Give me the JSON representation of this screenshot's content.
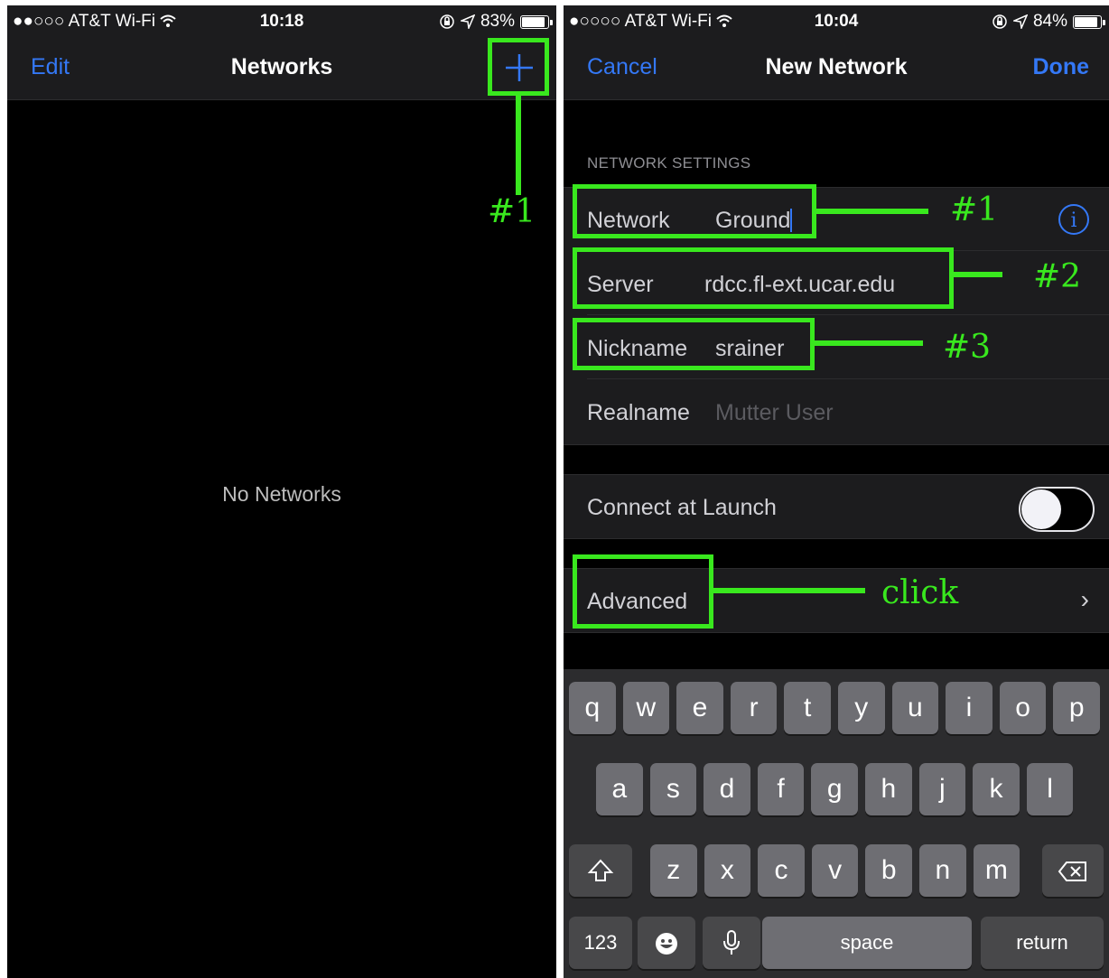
{
  "left_screen": {
    "status": {
      "carrier": "●●○○○ AT&T Wi-Fi",
      "time": "10:18",
      "battery": "83%"
    },
    "nav": {
      "edit": "Edit",
      "title": "Networks"
    },
    "empty_text": "No Networks",
    "annotation": "#1"
  },
  "right_screen": {
    "status": {
      "carrier": "●○○○○ AT&T Wi-Fi",
      "time": "10:04",
      "battery": "84%"
    },
    "nav": {
      "cancel": "Cancel",
      "title": "New Network",
      "done": "Done"
    },
    "section_header": "NETWORK SETTINGS",
    "fields": [
      {
        "label": "Network",
        "value": "Ground"
      },
      {
        "label": "Server",
        "value": "rdcc.fl-ext.ucar.edu"
      },
      {
        "label": "Nickname",
        "value": "srainer"
      },
      {
        "label": "Realname",
        "placeholder": "Mutter User"
      }
    ],
    "connect_label": "Connect at Launch",
    "connect_enabled": false,
    "advanced_label": "Advanced",
    "annotations": {
      "network": "#1",
      "server": "#2",
      "nickname": "#3",
      "advanced": "click"
    }
  },
  "keyboard": {
    "row1": [
      "q",
      "w",
      "e",
      "r",
      "t",
      "y",
      "u",
      "i",
      "o",
      "p"
    ],
    "row2": [
      "a",
      "s",
      "d",
      "f",
      "g",
      "h",
      "j",
      "k",
      "l"
    ],
    "row3": [
      "z",
      "x",
      "c",
      "v",
      "b",
      "n",
      "m"
    ],
    "numbers": "123",
    "space": "space",
    "return": "return"
  },
  "colors": {
    "accent": "#3478f6",
    "highlight": "#39e81e",
    "bar": "#1c1c1e",
    "key": "#6e6e73"
  },
  "icons": [
    "wifi-icon",
    "lock-rotation-icon",
    "location-icon",
    "battery-icon",
    "plus-icon",
    "info-icon",
    "chevron-right-icon",
    "shift-icon",
    "backspace-icon",
    "emoji-icon",
    "mic-icon"
  ]
}
